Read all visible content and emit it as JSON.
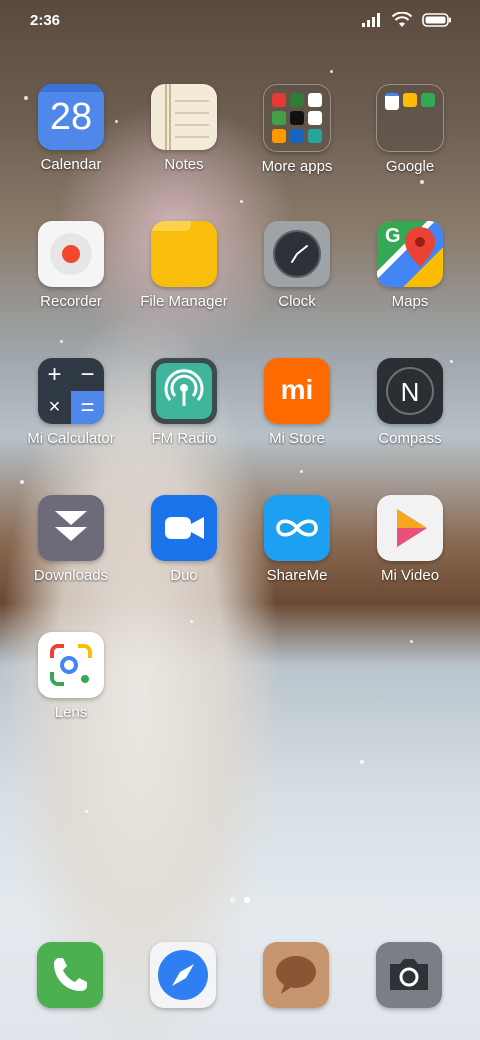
{
  "status_bar": {
    "time": "2:36"
  },
  "apps": [
    {
      "label": "Calendar",
      "icon": "calendar-icon",
      "day": "28"
    },
    {
      "label": "Notes",
      "icon": "notes-icon"
    },
    {
      "label": "More apps",
      "icon": "folder-icon"
    },
    {
      "label": "Google",
      "icon": "folder-icon"
    },
    {
      "label": "Recorder",
      "icon": "recorder-icon"
    },
    {
      "label": "File Manager",
      "icon": "folder-file-icon"
    },
    {
      "label": "Clock",
      "icon": "clock-icon"
    },
    {
      "label": "Maps",
      "icon": "maps-icon",
      "badge": "G"
    },
    {
      "label": "Mi Calculator",
      "icon": "calculator-icon"
    },
    {
      "label": "FM Radio",
      "icon": "radio-icon"
    },
    {
      "label": "Mi Store",
      "icon": "store-icon",
      "badge": "mi"
    },
    {
      "label": "Compass",
      "icon": "compass-icon",
      "badge": "N"
    },
    {
      "label": "Downloads",
      "icon": "download-icon"
    },
    {
      "label": "Duo",
      "icon": "video-camera-icon"
    },
    {
      "label": "ShareMe",
      "icon": "infinity-icon"
    },
    {
      "label": "Mi Video",
      "icon": "play-icon"
    },
    {
      "label": "Lens",
      "icon": "lens-icon"
    }
  ],
  "dock": [
    {
      "name": "Phone",
      "icon": "phone-icon"
    },
    {
      "name": "Browser",
      "icon": "compass-browser-icon"
    },
    {
      "name": "Messaging",
      "icon": "message-icon"
    },
    {
      "name": "Camera",
      "icon": "camera-icon"
    }
  ],
  "colors": {
    "calendar_blue": "#4f88e8",
    "notes_cream": "#f3ead8",
    "file_yellow": "#f9be0c",
    "mi_orange": "#ff6a00",
    "duo_blue": "#1a73e8",
    "shareme_blue": "#1ea0f2",
    "phone_green": "#4caf50"
  }
}
